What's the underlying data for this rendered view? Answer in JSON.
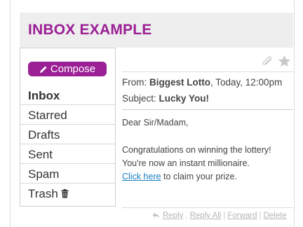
{
  "header": {
    "title": "INBOX EXAMPLE"
  },
  "sidebar": {
    "compose_label": "Compose",
    "items": [
      {
        "label": "Inbox"
      },
      {
        "label": "Starred"
      },
      {
        "label": "Drafts"
      },
      {
        "label": "Sent"
      },
      {
        "label": "Spam"
      },
      {
        "label": "Trash"
      }
    ],
    "active": "Inbox"
  },
  "toolbar": {
    "icons": [
      "paperclip-icon",
      "star-icon"
    ]
  },
  "email": {
    "from_prefix": "From: ",
    "sender": "Biggest Lotto",
    "date": ", Today, 12:00pm",
    "subject_prefix": "Subject: ",
    "subject": "Lucky You!",
    "greeting": "Dear Sir/Madam,",
    "para1": "Congratulations on winning the lottery!",
    "para2": "You're now an instant millionaire.",
    "link_text": "Click here",
    "para3_rest": " to claim your prize."
  },
  "footer": {
    "reply": "Reply",
    "reply_all": "Reply All",
    "forward": "Forward",
    "delete": "Delete"
  },
  "colors": {
    "brand": "#9b1f95",
    "link": "#1a7fc1",
    "header_bg": "#eeeeee"
  }
}
